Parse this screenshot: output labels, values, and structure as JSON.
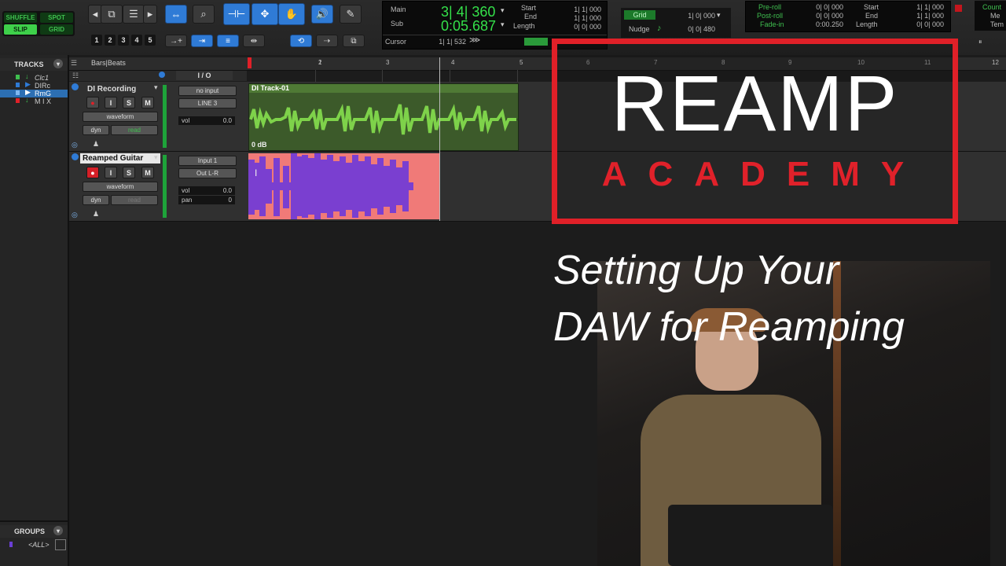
{
  "toolbar": {
    "modes": [
      "SHUFFLE",
      "SPOT",
      "SLIP",
      "GRID"
    ],
    "zoom_presets": [
      "1",
      "2",
      "3",
      "4",
      "5"
    ],
    "counter": {
      "main_label": "Main",
      "main_value": "3| 4| 360",
      "sub_label": "Sub",
      "sub_value": "0:05.687",
      "start_label": "Start",
      "end_label": "End",
      "length_label": "Length",
      "start_value": "1| 1| 000",
      "end_value": "1| 1| 000",
      "length_value": "0| 0| 000",
      "cursor_label": "Cursor",
      "cursor_value": "1| 1| 532"
    },
    "grid": {
      "grid_label": "Grid",
      "grid_value": "1| 0| 000",
      "nudge_label": "Nudge",
      "nudge_value": "0| 0| 480"
    },
    "transport": {
      "preroll_label": "Pre-roll",
      "postroll_label": "Post-roll",
      "fadein_label": "Fade-in",
      "preroll_value": "0| 0| 000",
      "postroll_value": "0| 0| 000",
      "fadein_value": "0:00.250",
      "start_label": "Start",
      "end_label": "End",
      "length_label": "Length",
      "start_value": "1| 1| 000",
      "end_value": "1| 1| 000",
      "length_value": "0| 0| 000",
      "count_label": "Count",
      "me_label": "Me",
      "te_label": "Tem"
    }
  },
  "tracklist": {
    "header": "TRACKS",
    "items": [
      {
        "name": "Clc1",
        "color": "#3fbf4f"
      },
      {
        "name": "DIRc",
        "color": "#2f7bd6"
      },
      {
        "name": "RmG",
        "color": "#2f7bd6"
      },
      {
        "name": "M I X",
        "color": "#e02028"
      }
    ],
    "groups_header": "GROUPS",
    "groups_all": "<ALL>"
  },
  "ruler": {
    "label": "Bars|Beats",
    "io_label": "I / O",
    "bars": [
      "1",
      "2",
      "3",
      "4",
      "5",
      "6",
      "7",
      "8",
      "9",
      "10",
      "11",
      "12"
    ]
  },
  "tracks": [
    {
      "name": "DI Recording",
      "view": "waveform",
      "dyn_label": "dyn",
      "automation": "read",
      "input": "no input",
      "output": "LINE 3",
      "vol_label": "vol",
      "vol_value": "0.0",
      "clip_name": "DI Track-01",
      "clip_gain": "0 dB"
    },
    {
      "name": "Reamped Guitar",
      "view": "waveform",
      "dyn_label": "dyn",
      "automation": "read",
      "input": "Input 1",
      "output": "Out L-R",
      "vol_label": "vol",
      "vol_value": "0.0",
      "pan_label": "pan",
      "pan_value": "0"
    }
  ],
  "overlay": {
    "title": "REAMP",
    "brand": "ACADEMY",
    "subtitle_line1": "Setting Up Your",
    "subtitle_line2": "DAW for Reamping",
    "accent_color": "#e02028"
  }
}
